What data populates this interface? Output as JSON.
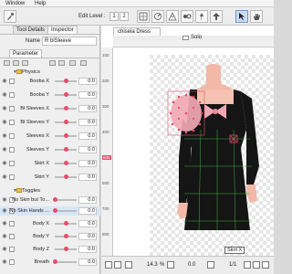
{
  "menu": {
    "window": "Window",
    "help": "Help"
  },
  "toolbar": {
    "edit_level_label": "Edit Level :",
    "level_1": "1",
    "level_2": "2"
  },
  "panel": {
    "tabs": [
      "Tool Details",
      "Inspector"
    ],
    "name_label": "Name",
    "name_value": "R blSleeve",
    "subtab": "Parameter",
    "physics_group": "Physics",
    "toggles_group": "Toggles"
  },
  "params": [
    {
      "label": "Booba X",
      "value": "0.0",
      "pos": 0.5
    },
    {
      "label": "Booba Y",
      "value": "0.0",
      "pos": 0.5
    },
    {
      "label": "Bl Sleeves X",
      "value": "0.0",
      "pos": 0.5
    },
    {
      "label": "Bl Sleeves Y",
      "value": "0.0",
      "pos": 0.5
    },
    {
      "label": "Sleeves X",
      "value": "0.0",
      "pos": 0.5
    },
    {
      "label": "Sleeves Y",
      "value": "0.0",
      "pos": 0.5
    },
    {
      "label": "Skirt X",
      "value": "0.0",
      "pos": 0.5
    },
    {
      "label": "Skirt Y",
      "value": "0.0",
      "pos": 0.5
    }
  ],
  "toggles": [
    {
      "label": "No Skin but To...",
      "value": "0.0",
      "pos": 0.0
    },
    {
      "label": "No Skin Hands ...",
      "value": "0.0",
      "pos": 0.0
    }
  ],
  "body_params": [
    {
      "label": "Body X",
      "value": "0.0",
      "pos": 0.5
    },
    {
      "label": "Body Y",
      "value": "0.0",
      "pos": 0.5
    },
    {
      "label": "Body Z",
      "value": "0.0",
      "pos": 0.5
    },
    {
      "label": "Breath",
      "value": "0.0",
      "pos": 0.0
    }
  ],
  "canvas": {
    "doc_tab": "chisela Dress",
    "solo_label": "Solo",
    "ruler_ticks": [
      "100",
      "200",
      "300",
      "400",
      "500",
      "600",
      "700",
      "800"
    ],
    "tooltip": "Skirt X"
  },
  "status": {
    "zoom": "14.3",
    "zoom_unit": "%",
    "angle": "0.0",
    "page": "1/1"
  },
  "colors": {
    "accent_pink": "#e64d6b",
    "dress_black": "#151515",
    "bow_pink": "#f2a8b4"
  }
}
